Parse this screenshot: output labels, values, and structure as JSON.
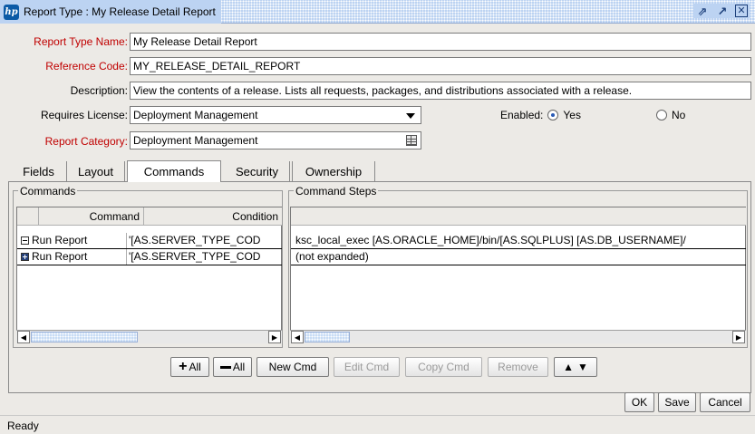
{
  "window": {
    "title": "Report Type : My Release Detail Report",
    "controls": [
      "restore-icon",
      "maximize-icon",
      "close-icon"
    ]
  },
  "form": {
    "report_type_name_label": "Report Type Name:",
    "report_type_name_value": "My Release Detail Report",
    "reference_code_label": "Reference Code:",
    "reference_code_value": "MY_RELEASE_DETAIL_REPORT",
    "description_label": "Description:",
    "description_value": "View the contents of a release. Lists all requests, packages, and distributions associated with a release.",
    "requires_license_label": "Requires License:",
    "requires_license_value": "Deployment Management",
    "enabled_label": "Enabled:",
    "enabled_yes": "Yes",
    "enabled_no": "No",
    "enabled_selected": "Yes",
    "report_category_label": "Report Category:",
    "report_category_value": "Deployment Management"
  },
  "tabs": [
    {
      "label": "Fields"
    },
    {
      "label": "Layout"
    },
    {
      "label": "Commands",
      "active": true
    },
    {
      "label": "Security"
    },
    {
      "label": "Ownership"
    }
  ],
  "commands_panel": {
    "title": "Commands",
    "columns": [
      "Command",
      "Condition"
    ],
    "rows": [
      {
        "command": "Run Report",
        "condition": "'[AS.SERVER_TYPE_COD",
        "expanded": true
      },
      {
        "command": "Run Report",
        "condition": "'[AS.SERVER_TYPE_COD",
        "expanded": false
      }
    ]
  },
  "steps_panel": {
    "title": "Command Steps",
    "rows": [
      "ksc_local_exec [AS.ORACLE_HOME]/bin/[AS.SQLPLUS] [AS.DB_USERNAME]/",
      "(not expanded)"
    ]
  },
  "toolbar": {
    "add_all": "All",
    "remove_all": "All",
    "new_cmd": "New Cmd",
    "edit_cmd": "Edit Cmd",
    "copy_cmd": "Copy Cmd",
    "remove": "Remove"
  },
  "footer": {
    "ok": "OK",
    "save": "Save",
    "cancel": "Cancel"
  },
  "status": "Ready",
  "colors": {
    "required_label": "#c00000",
    "titlebar": "#bcd3f2"
  }
}
